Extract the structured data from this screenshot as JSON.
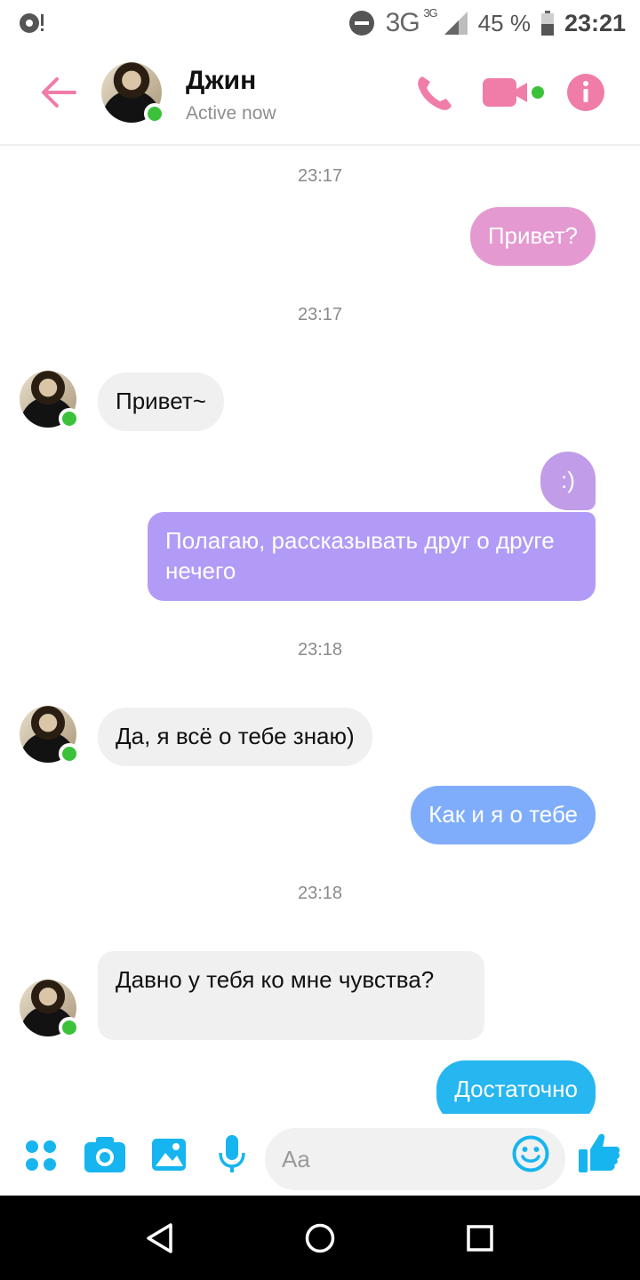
{
  "status_bar": {
    "network": "3G",
    "network_small": "3G",
    "battery": "45 %",
    "time": "23:21"
  },
  "header": {
    "contact_name": "Джин",
    "status": "Active now"
  },
  "messages": [
    {
      "type": "timestamp",
      "text": "23:17"
    },
    {
      "type": "outgoing",
      "text": "Привет?"
    },
    {
      "type": "timestamp",
      "text": "23:17"
    },
    {
      "type": "incoming",
      "text": "Привет~"
    },
    {
      "type": "outgoing",
      "text": ":)"
    },
    {
      "type": "outgoing",
      "text": "Полагаю, рассказывать друг о друге нечего"
    },
    {
      "type": "timestamp",
      "text": "23:18"
    },
    {
      "type": "incoming",
      "text": "Да, я всё о тебе знаю)"
    },
    {
      "type": "outgoing",
      "text": "Как и я о тебе"
    },
    {
      "type": "timestamp",
      "text": "23:18"
    },
    {
      "type": "incoming",
      "text": "Давно у тебя ко мне чувства?"
    },
    {
      "type": "outgoing",
      "text": "Достаточно"
    }
  ],
  "composer": {
    "placeholder": "Aa"
  },
  "colors": {
    "accent_pink": "#f07ca8",
    "bubble_pink": "#e49ad1",
    "bubble_purple": "#b19bf6",
    "bubble_blue": "#7fadfb",
    "bubble_cyan": "#26b6f0",
    "composer_blue": "#17b5ef",
    "online_green": "#3cc13b"
  },
  "icons": {
    "back": "arrow-left-icon",
    "call": "phone-icon",
    "video": "video-camera-icon",
    "info": "info-icon",
    "apps": "grid-dots-icon",
    "camera": "camera-icon",
    "gallery": "image-icon",
    "mic": "microphone-icon",
    "emoji": "smiley-icon",
    "like": "thumbs-up-icon"
  }
}
